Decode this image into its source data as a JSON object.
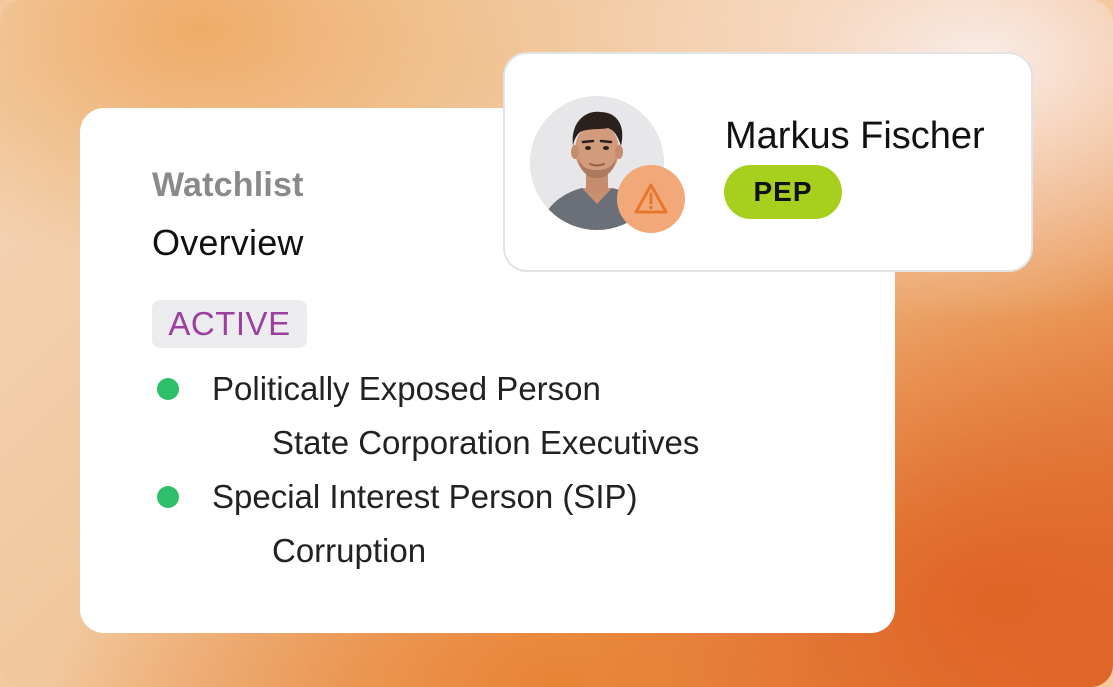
{
  "watchlist": {
    "eyebrow": "Watchlist",
    "title": "Overview",
    "status": "ACTIVE",
    "items": [
      {
        "title": "Politically Exposed Person",
        "subtitle": "State Corporation Executives",
        "indicator_color": "#2fbf6a"
      },
      {
        "title": "Special Interest Person (SIP)",
        "subtitle": "Corruption",
        "indicator_color": "#2fbf6a"
      }
    ]
  },
  "profile": {
    "name": "Markus Fischer",
    "tag": "PEP",
    "avatar_icon": "person-photo",
    "alert_icon": "warning-triangle-icon"
  },
  "colors": {
    "status_text": "#9b3fa0",
    "pep_badge": "#a6cf1e",
    "alert_badge": "#f2a878",
    "alert_icon": "#e8772e"
  }
}
